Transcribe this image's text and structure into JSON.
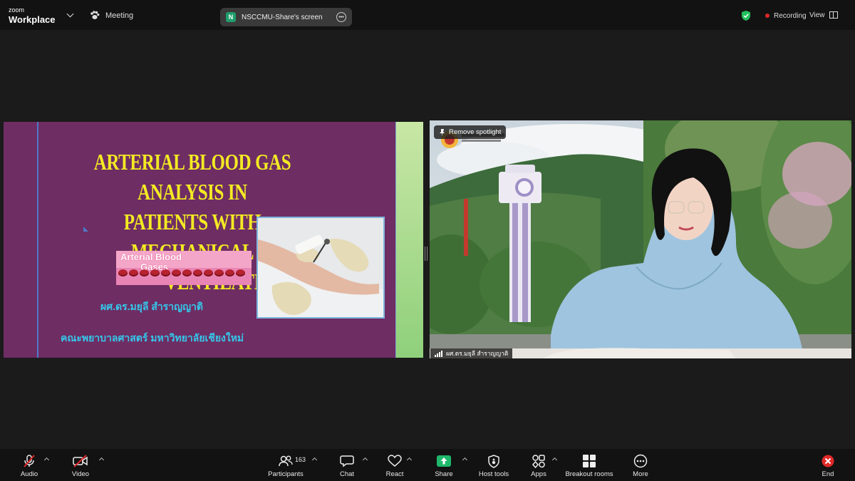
{
  "topbar": {
    "brand_small": "zoom",
    "brand_big": "Workplace",
    "meeting_label": "Meeting",
    "share_badge": "N",
    "share_title": "NSCCMU-Share's screen",
    "recording_label": "Recording",
    "view_label": "View"
  },
  "slide": {
    "title_lines": [
      "ARTERIAL BLOOD GAS ANALYSIS IN",
      "PATIENTS WITH MECHANICAL",
      "VENTILATION"
    ],
    "image_text_line1": "Arterial Blood",
    "image_text_line2": "Gases",
    "author": "ผศ.ดร.มยุลี สำราญญาติ",
    "faculty": "คณะพยาบาลศาสตร์ มหาวิทยาลัยเชียงใหม่"
  },
  "video": {
    "spotlight_label": "Remove spotlight",
    "participant_name": "ผศ.ดร.มยุลี สำราญญาติ"
  },
  "toolbar": {
    "audio": "Audio",
    "video": "Video",
    "participants": "Participants",
    "participants_count": "163",
    "chat": "Chat",
    "react": "React",
    "share": "Share",
    "host_tools": "Host tools",
    "apps": "Apps",
    "breakout_rooms": "Breakout rooms",
    "more": "More",
    "end": "End"
  },
  "colors": {
    "slide_bg": "#6e2d63",
    "title_yellow": "#f3ea23",
    "thai_cyan": "#35c7ea",
    "share_green": "#1fb86b",
    "recording_red": "#e02828",
    "end_red": "#e02828"
  }
}
